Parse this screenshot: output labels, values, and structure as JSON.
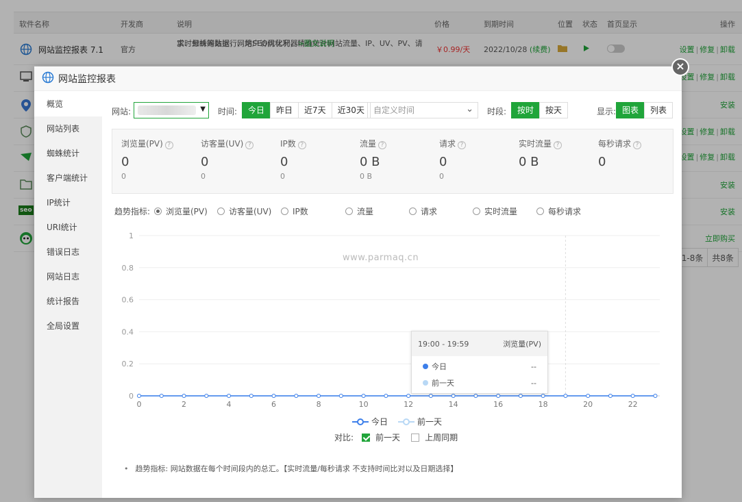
{
  "bg": {
    "headers": [
      "软件名称",
      "开发商",
      "说明",
      "价格",
      "到期时间",
      "位置",
      "状态",
      "首页显示",
      "操作"
    ],
    "first_row": {
      "name": "网站监控报表 7.1",
      "vendor": "官方",
      "desc_line1": "实时分析网站运行、用户访问状况，精确统计网站流量、IP、UV、PV、请",
      "desc_line2": "求、蜘蛛等数据，网站SEO优化利器",
      "desc_link": ">图文说明",
      "price": "￥0.99/天",
      "expire": "2022/10/28",
      "renew": "(续费)",
      "ops": [
        "设置",
        "修复",
        "卸载"
      ]
    },
    "row_ops": [
      [
        "设置",
        "修复",
        "卸载"
      ],
      [
        "安装"
      ],
      [
        "设置",
        "修复",
        "卸载"
      ],
      [
        "设置",
        "修复",
        "卸载"
      ],
      [
        "安装"
      ],
      [
        "安装"
      ],
      [
        "立即购买"
      ]
    ],
    "seo_badge": "seo",
    "pager": [
      "1-8条",
      "共8条"
    ]
  },
  "modal": {
    "title": "网站监控报表",
    "close": "×",
    "sidebar": [
      "概览",
      "网站列表",
      "蜘蛛统计",
      "客户端统计",
      "IP统计",
      "URI统计",
      "错误日志",
      "网站日志",
      "统计报告",
      "全局设置"
    ],
    "filter": {
      "site_label": "网站:",
      "time_label": "时间:",
      "time_buttons": [
        "今日",
        "昨日",
        "近7天",
        "近30天"
      ],
      "custom_time_placeholder": "自定义时间",
      "period_label": "时段:",
      "period_buttons": [
        "按时",
        "按天"
      ],
      "display_label": "显示:",
      "display_buttons": [
        "图表",
        "列表"
      ]
    },
    "stats": [
      {
        "label": "浏览量(PV)",
        "value": "0",
        "sub": "0"
      },
      {
        "label": "访客量(UV)",
        "value": "0",
        "sub": "0"
      },
      {
        "label": "IP数",
        "value": "0",
        "sub": "0"
      },
      {
        "label": "流量",
        "value": "0 B",
        "sub": "0 B"
      },
      {
        "label": "请求",
        "value": "0",
        "sub": "0"
      },
      {
        "label": "实时流量",
        "value": "0 B",
        "sub": ""
      },
      {
        "label": "每秒请求",
        "value": "0",
        "sub": ""
      }
    ],
    "trend": {
      "label": "趋势指标:",
      "options": [
        "浏览量(PV)",
        "访客量(UV)",
        "IP数",
        "流量",
        "请求",
        "实时流量",
        "每秒请求"
      ],
      "selected": 0
    },
    "watermark": "www.parmaq.cn",
    "tooltip": {
      "range": "19:00 - 19:59",
      "metric": "浏览量(PV)",
      "rows": [
        {
          "name": "今日",
          "value": "--",
          "color": "#3d7fea"
        },
        {
          "name": "前一天",
          "value": "--",
          "color": "#b8d8f5"
        }
      ]
    },
    "legend": [
      "今日",
      "前一天"
    ],
    "compare": {
      "label": "对比:",
      "options": [
        "前一天",
        "上周同期"
      ],
      "checked": [
        true,
        false
      ]
    },
    "note": "趋势指标: 网站数据在每个时间段内的总汇。【实时流量/每秒请求 不支持时间比对以及日期选择】"
  },
  "chart_data": {
    "type": "line",
    "x": [
      0,
      1,
      2,
      3,
      4,
      5,
      6,
      7,
      8,
      9,
      10,
      11,
      12,
      13,
      14,
      15,
      16,
      17,
      18,
      19,
      20,
      21,
      22,
      23
    ],
    "xticks": [
      0,
      2,
      4,
      6,
      8,
      10,
      12,
      14,
      16,
      18,
      20,
      22
    ],
    "yticks": [
      0,
      0.2,
      0.4,
      0.6,
      0.8,
      1
    ],
    "ylim": [
      0,
      1
    ],
    "series": [
      {
        "name": "今日",
        "values": [
          0,
          0,
          0,
          0,
          0,
          0,
          0,
          0,
          0,
          0,
          0,
          0,
          0,
          0,
          0,
          0,
          0,
          0,
          0,
          0,
          0,
          0,
          0,
          0
        ],
        "color": "#3d7fea"
      },
      {
        "name": "前一天",
        "values": [
          0,
          0,
          0,
          0,
          0,
          0,
          0,
          0,
          0,
          0,
          0,
          0,
          0,
          0,
          0,
          0,
          0,
          0,
          0,
          0,
          0,
          0,
          0,
          0
        ],
        "color": "#b8d8f5"
      }
    ],
    "hover_x": 19,
    "grid": true
  }
}
